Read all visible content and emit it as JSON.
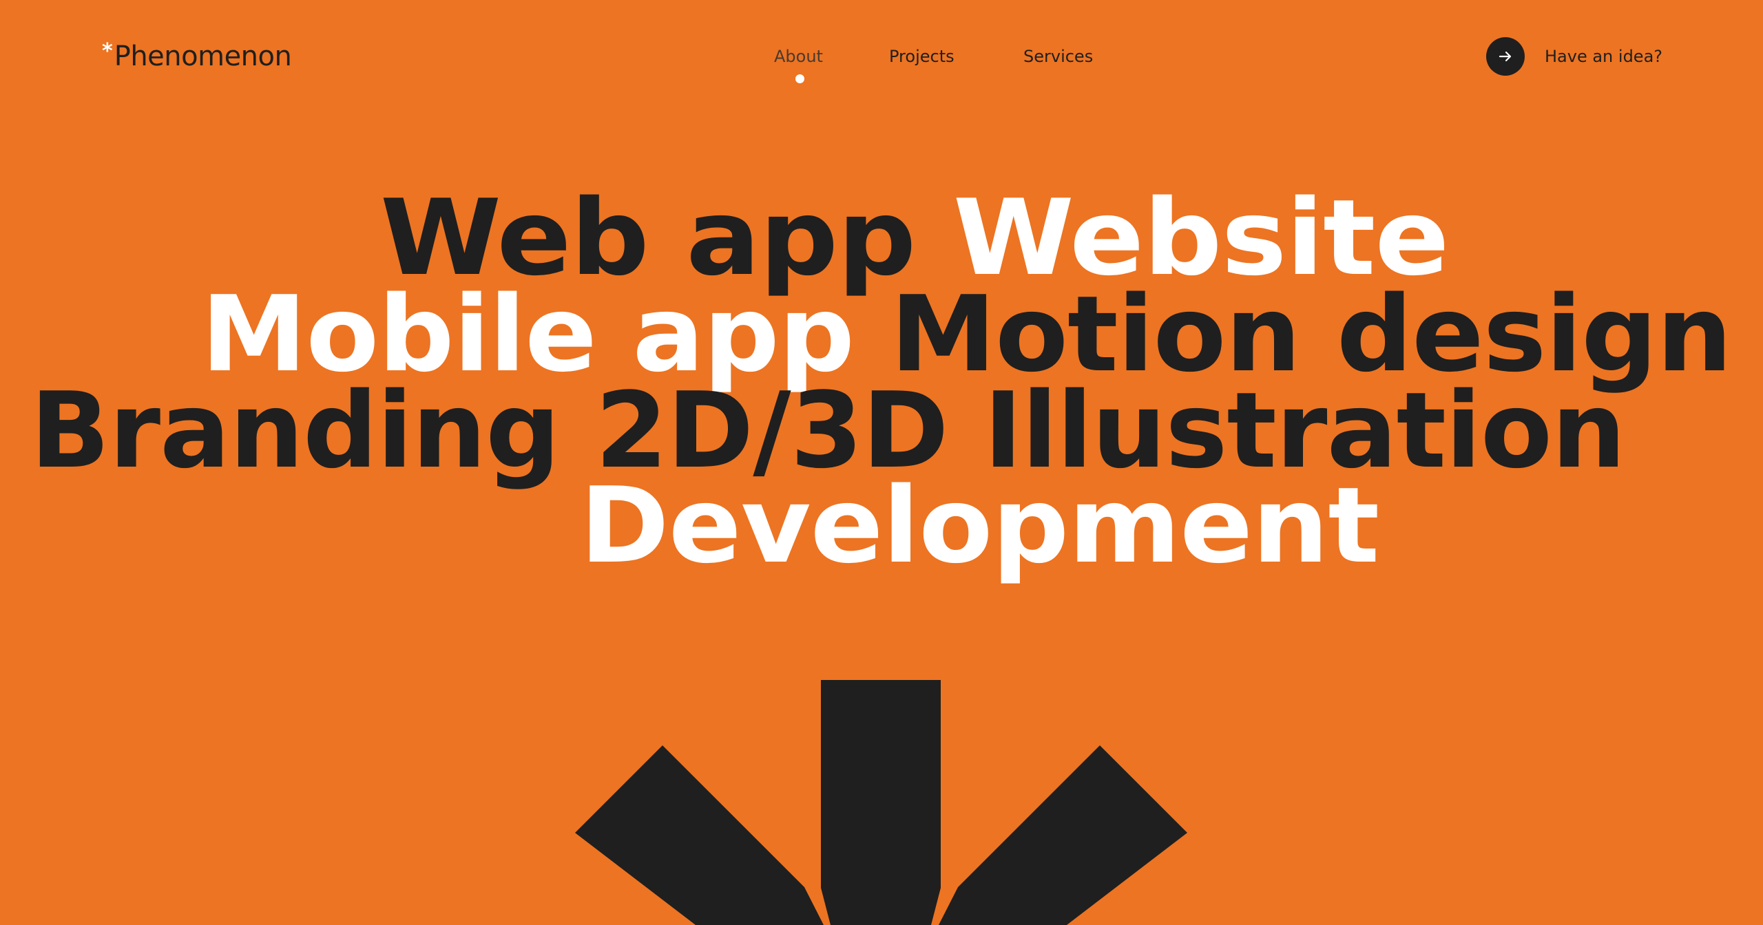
{
  "header": {
    "logo_mark": "*",
    "logo_text": "Phenomenon",
    "nav": [
      {
        "label": "About",
        "active": true
      },
      {
        "label": "Projects",
        "active": false
      },
      {
        "label": "Services",
        "active": false
      }
    ],
    "cta_label": "Have an idea?",
    "cta_icon": "arrow-right-icon"
  },
  "hero": {
    "line1": [
      "Web app",
      "Website"
    ],
    "line2": [
      "Mobile app",
      "Motion design"
    ],
    "line3": [
      "Branding",
      "2D/3D Illustration"
    ],
    "line4": [
      "Development"
    ]
  },
  "colors": {
    "background": "#ed7422",
    "dark": "#1f1f1f",
    "light": "#ffffff"
  },
  "decor": {
    "icon": "asterisk-icon"
  }
}
